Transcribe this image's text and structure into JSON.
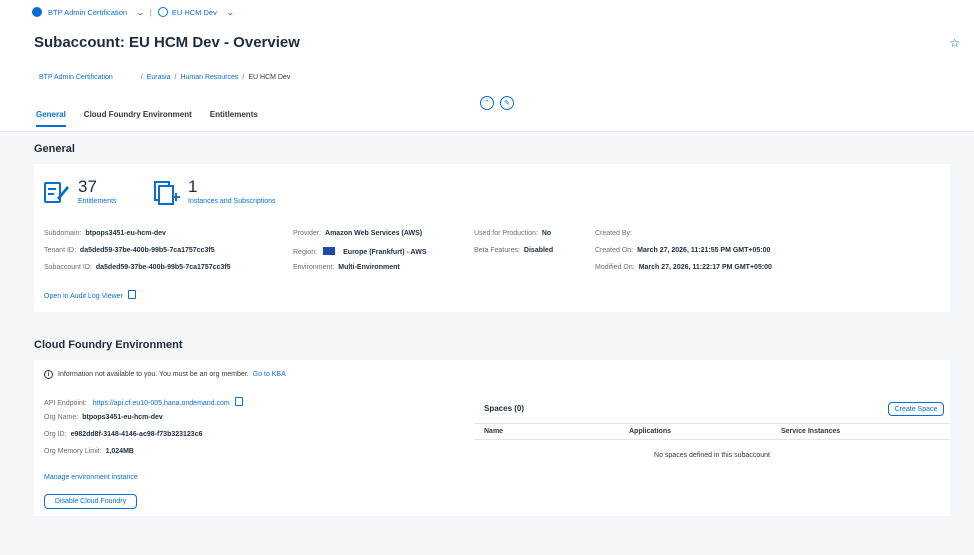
{
  "shell": {
    "global_account": "BTP Admin Certification",
    "subaccount": "EU HCM Dev"
  },
  "header": {
    "title": "Subaccount: EU HCM Dev - Overview",
    "breadcrumb": [
      "BTP Admin Certification",
      "Eurasia",
      "Human Resources",
      "EU HCM Dev"
    ],
    "tabs": [
      "General",
      "Cloud Foundry Environment",
      "Entitlements"
    ]
  },
  "general": {
    "title": "General",
    "entitlements_count": "37",
    "entitlements_label": "Entitlements",
    "instances_count": "1",
    "instances_label": "Instances and Subscriptions",
    "subdomain_label": "Subdomain:",
    "subdomain": "btpops3451-eu-hcm-dev",
    "tenant_label": "Tenant ID:",
    "tenant": "da5ded59-37be-400b-99b5-7ca1757cc3f5",
    "subaccount_id_label": "Subaccount ID:",
    "subaccount_id": "da5ded59-37be-400b-99b5-7ca1757cc3f5",
    "provider_label": "Provider:",
    "provider": "Amazon Web Services (AWS)",
    "region_label": "Region:",
    "region": "Europe (Frankfurt) - AWS",
    "environment_label": "Environment:",
    "environment": "Multi-Environment",
    "production_label": "Used for Production:",
    "production": "No",
    "beta_label": "Beta Features:",
    "beta": "Disabled",
    "created_by_label": "Created By:",
    "created_on_label": "Created On:",
    "created_on": "March 27, 2026, 11:21:55 PM GMT+05:00",
    "modified_on_label": "Modified On:",
    "modified_on": "March 27, 2026, 11:22:17 PM GMT+05:00",
    "audit_link": "Open in Audit Log Viewer"
  },
  "cf": {
    "title": "Cloud Foundry Environment",
    "info_text": "Information not available to you. You must be an org member.",
    "info_link": "Go to KBA",
    "api_label": "API Endpoint:",
    "api": "https://api.cf.eu10-005.hana.ondemand.com",
    "org_name_label": "Org Name:",
    "org_name": "btpops3451-eu-hcm-dev",
    "org_id_label": "Org ID:",
    "org_id": "e982dd8f-3148-4146-ac98-f73b323123c6",
    "mem_label": "Org Memory Limit:",
    "mem": "1,024MB",
    "manage_link": "Manage environment instance",
    "disable_button": "Disable Cloud Foundry",
    "spaces_title": "Spaces (0)",
    "create_space": "Create Space",
    "columns": [
      "Name",
      "Applications",
      "Service Instances"
    ],
    "empty_text": "No spaces defined in this subaccount"
  }
}
